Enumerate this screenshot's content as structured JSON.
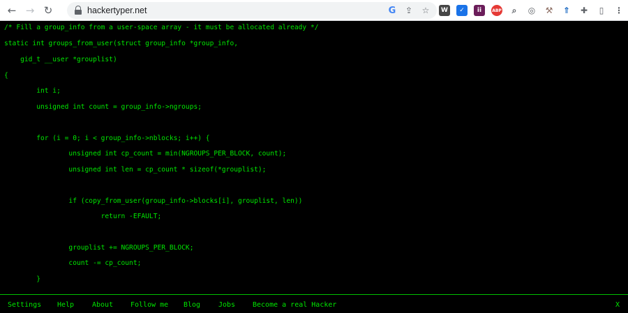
{
  "browser": {
    "url": "hackertyper.net",
    "omnibox_icons": [
      "google-lens-icon",
      "share-icon",
      "bookmark-star-icon"
    ],
    "extensions": [
      {
        "name": "wordpress-extension-icon",
        "glyph": "W",
        "color": "#464646"
      },
      {
        "name": "check-extension-icon",
        "glyph": "✓",
        "color": "#1a73e8"
      },
      {
        "name": "ii-extension-icon",
        "glyph": "ii",
        "color": "#6b1d5a"
      },
      {
        "name": "abp-extension-icon",
        "glyph": "ABP",
        "color": "#e53935"
      },
      {
        "name": "search-extension-icon",
        "glyph": "⌕",
        "color": "#5f6368"
      },
      {
        "name": "compass-extension-icon",
        "glyph": "◎",
        "color": "#5f6368"
      },
      {
        "name": "tools-extension-icon",
        "glyph": "⚒",
        "color": "#8d6e63"
      },
      {
        "name": "tree-extension-icon",
        "glyph": "⇑",
        "color": "#1565c0"
      },
      {
        "name": "puzzle-extension-icon",
        "glyph": "✚",
        "color": "#5f6368"
      },
      {
        "name": "sidebar-icon",
        "glyph": "▯",
        "color": "#5f6368"
      },
      {
        "name": "menu-dots-icon",
        "glyph": "⋮",
        "color": "#5f6368"
      }
    ]
  },
  "code_lines": [
    "/* Fill a group_info from a user-space array - it must be allocated already */",
    "static int groups_from_user(struct group_info *group_info,",
    "    gid_t __user *grouplist)",
    "{",
    "        int i;",
    "        unsigned int count = group_info->ngroups;",
    "",
    "        for (i = 0; i < group_info->nblocks; i++) {",
    "                unsigned int cp_count = min(NGROUPS_PER_BLOCK, count);",
    "                unsigned int len = cp_count * sizeof(*grouplist);",
    "",
    "                if (copy_from_user(group_info->blocks[i], grouplist, len))",
    "                        return -EFAULT;",
    "",
    "                grouplist += NGROUPS_PER_BLOCK;",
    "                count -= cp_count;",
    "        }"
  ],
  "footer": {
    "settings": "Settings",
    "help": "Help",
    "about": "About",
    "follow": "Follow me",
    "blog": "Blog",
    "jobs": "Jobs",
    "hacker": "Become a real Hacker",
    "close": "X"
  },
  "colors": {
    "code_green": "#00e600",
    "background": "#000000"
  }
}
